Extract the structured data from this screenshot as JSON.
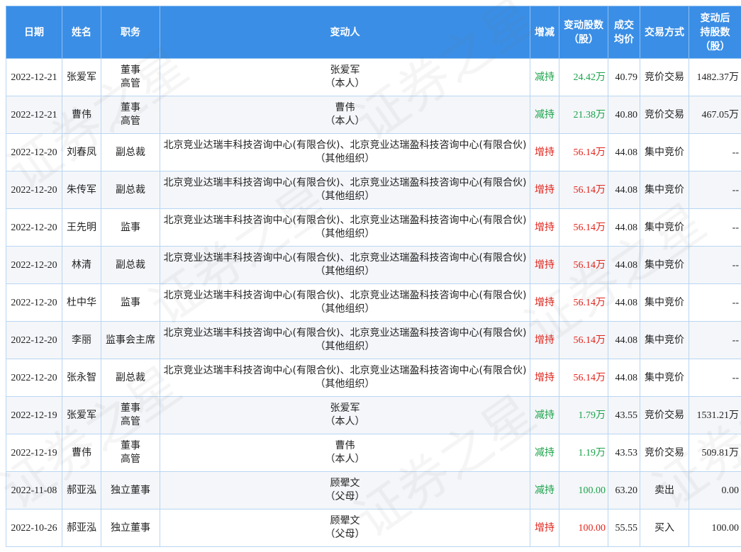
{
  "headers": {
    "date": "日期",
    "name": "姓名",
    "role": "职务",
    "holder": "变动人",
    "direction": "增减",
    "change_shares_l1": "变动股数",
    "change_shares_l2": "（股）",
    "price_l1": "成交",
    "price_l2": "均价",
    "method": "交易方式",
    "after_l1": "变动后",
    "after_l2": "持股数",
    "after_l3": "（股）"
  },
  "watermark_text": "证券之星",
  "colors": {
    "header_bg": "#3a8ee6",
    "increase": "#e2231a",
    "decrease": "#1aa34a"
  },
  "rows": [
    {
      "date": "2022-12-21",
      "name": "张爱军",
      "role_l1": "董事",
      "role_l2": "高管",
      "holder_l1": "张爱军",
      "holder_l2": "（本人）",
      "direction": "减持",
      "dir": "down",
      "shares": "24.42万",
      "price": "40.79",
      "method": "竞价交易",
      "after": "1482.37万"
    },
    {
      "date": "2022-12-21",
      "name": "曹伟",
      "role_l1": "董事",
      "role_l2": "高管",
      "holder_l1": "曹伟",
      "holder_l2": "（本人）",
      "direction": "减持",
      "dir": "down",
      "shares": "21.38万",
      "price": "40.80",
      "method": "竞价交易",
      "after": "467.05万"
    },
    {
      "date": "2022-12-20",
      "name": "刘春凤",
      "role_l1": "副总裁",
      "role_l2": "",
      "holder_l1": "北京竞业达瑞丰科技咨询中心(有限合伙)、北京竞业达瑞盈科技咨询中心(有限合伙)",
      "holder_l2": "（其他组织）",
      "direction": "增持",
      "dir": "up",
      "shares": "56.14万",
      "price": "44.08",
      "method": "集中竞价",
      "after": "--"
    },
    {
      "date": "2022-12-20",
      "name": "朱传军",
      "role_l1": "副总裁",
      "role_l2": "",
      "holder_l1": "北京竞业达瑞丰科技咨询中心(有限合伙)、北京竞业达瑞盈科技咨询中心(有限合伙)",
      "holder_l2": "（其他组织）",
      "direction": "增持",
      "dir": "up",
      "shares": "56.14万",
      "price": "44.08",
      "method": "集中竞价",
      "after": "--"
    },
    {
      "date": "2022-12-20",
      "name": "王先明",
      "role_l1": "监事",
      "role_l2": "",
      "holder_l1": "北京竞业达瑞丰科技咨询中心(有限合伙)、北京竞业达瑞盈科技咨询中心(有限合伙)",
      "holder_l2": "（其他组织）",
      "direction": "增持",
      "dir": "up",
      "shares": "56.14万",
      "price": "44.08",
      "method": "集中竞价",
      "after": "--"
    },
    {
      "date": "2022-12-20",
      "name": "林清",
      "role_l1": "副总裁",
      "role_l2": "",
      "holder_l1": "北京竞业达瑞丰科技咨询中心(有限合伙)、北京竞业达瑞盈科技咨询中心(有限合伙)",
      "holder_l2": "（其他组织）",
      "direction": "增持",
      "dir": "up",
      "shares": "56.14万",
      "price": "44.08",
      "method": "集中竞价",
      "after": "--"
    },
    {
      "date": "2022-12-20",
      "name": "杜中华",
      "role_l1": "监事",
      "role_l2": "",
      "holder_l1": "北京竞业达瑞丰科技咨询中心(有限合伙)、北京竞业达瑞盈科技咨询中心(有限合伙)",
      "holder_l2": "（其他组织）",
      "direction": "增持",
      "dir": "up",
      "shares": "56.14万",
      "price": "44.08",
      "method": "集中竞价",
      "after": "--"
    },
    {
      "date": "2022-12-20",
      "name": "李丽",
      "role_l1": "监事会主席",
      "role_l2": "",
      "holder_l1": "北京竞业达瑞丰科技咨询中心(有限合伙)、北京竞业达瑞盈科技咨询中心(有限合伙)",
      "holder_l2": "（其他组织）",
      "direction": "增持",
      "dir": "up",
      "shares": "56.14万",
      "price": "44.08",
      "method": "集中竞价",
      "after": "--"
    },
    {
      "date": "2022-12-20",
      "name": "张永智",
      "role_l1": "副总裁",
      "role_l2": "",
      "holder_l1": "北京竞业达瑞丰科技咨询中心(有限合伙)、北京竞业达瑞盈科技咨询中心(有限合伙)",
      "holder_l2": "（其他组织）",
      "direction": "增持",
      "dir": "up",
      "shares": "56.14万",
      "price": "44.08",
      "method": "集中竞价",
      "after": "--"
    },
    {
      "date": "2022-12-19",
      "name": "张爱军",
      "role_l1": "董事",
      "role_l2": "高管",
      "holder_l1": "张爱军",
      "holder_l2": "（本人）",
      "direction": "减持",
      "dir": "down",
      "shares": "1.79万",
      "price": "43.55",
      "method": "竞价交易",
      "after": "1531.21万"
    },
    {
      "date": "2022-12-19",
      "name": "曹伟",
      "role_l1": "董事",
      "role_l2": "高管",
      "holder_l1": "曹伟",
      "holder_l2": "（本人）",
      "direction": "减持",
      "dir": "down",
      "shares": "1.19万",
      "price": "43.53",
      "method": "竞价交易",
      "after": "509.81万"
    },
    {
      "date": "2022-11-08",
      "name": "郝亚泓",
      "role_l1": "独立董事",
      "role_l2": "",
      "holder_l1": "顾翚文",
      "holder_l2": "（父母）",
      "direction": "减持",
      "dir": "down",
      "shares": "100.00",
      "price": "63.20",
      "method": "卖出",
      "after": "0.00"
    },
    {
      "date": "2022-10-26",
      "name": "郝亚泓",
      "role_l1": "独立董事",
      "role_l2": "",
      "holder_l1": "顾翚文",
      "holder_l2": "（父母）",
      "direction": "增持",
      "dir": "up",
      "shares": "100.00",
      "price": "55.55",
      "method": "买入",
      "after": "100.00"
    }
  ]
}
